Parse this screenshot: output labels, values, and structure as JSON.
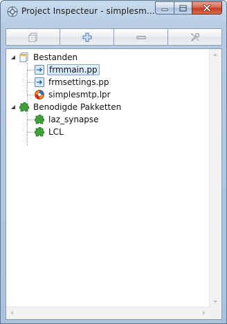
{
  "window": {
    "title": "Project Inspecteur - simplesm..."
  },
  "caption_buttons": {
    "minimize_icon": "minimize-icon",
    "maximize_icon": "maximize-icon",
    "close_icon": "close-icon"
  },
  "toolbar": {
    "buttons": [
      {
        "icon": "options-icon"
      },
      {
        "icon": "add-icon"
      },
      {
        "icon": "remove-icon"
      },
      {
        "icon": "tools-icon"
      }
    ]
  },
  "tree": {
    "items": [
      {
        "label": "Bestanden",
        "icon": "files-folder-icon",
        "expanded": true,
        "level": 0
      },
      {
        "label": "frmmain.pp",
        "icon": "pascal-unit-icon",
        "level": 1,
        "selected": true
      },
      {
        "label": "frmsettings.pp",
        "icon": "pascal-unit-icon",
        "level": 1
      },
      {
        "label": "simplesmtp.lpr",
        "icon": "lazarus-project-icon",
        "level": 1
      },
      {
        "label": "Benodigde Pakketten",
        "icon": "package-icon",
        "expanded": true,
        "level": 0
      },
      {
        "label": "laz_synapse",
        "icon": "package-icon",
        "level": 1
      },
      {
        "label": "LCL",
        "icon": "package-icon",
        "level": 1
      }
    ]
  },
  "colors": {
    "accent": "#7da2ce",
    "package_green": "#3fa13a",
    "close_red": "#c23a20"
  }
}
